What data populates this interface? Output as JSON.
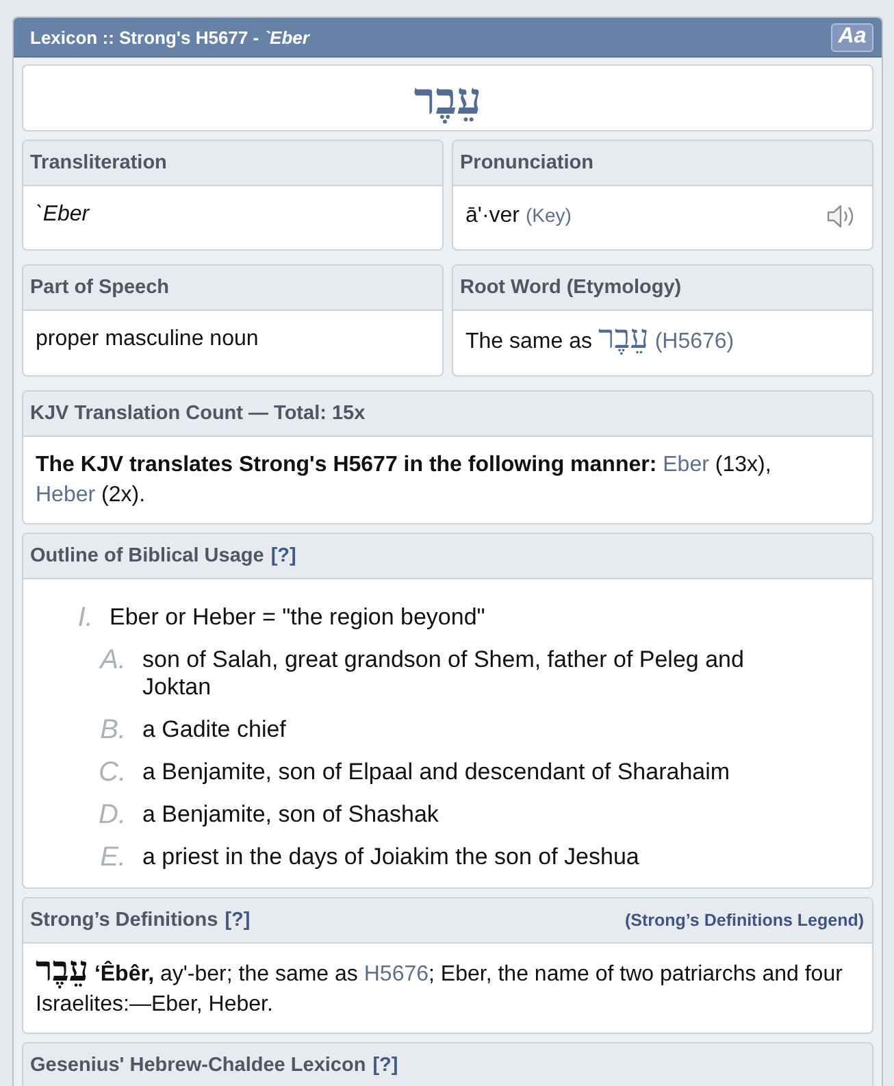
{
  "panel": {
    "title": "Lexicon :: Strong's H5677 - *`Eber*",
    "font_button": "Aa"
  },
  "headword": "עֵבֶר",
  "transliteration": {
    "heading": "Transliteration",
    "value": "`Eber"
  },
  "pronunciation": {
    "heading": "Pronunciation",
    "value": "ā'·ver",
    "key_link": "(Key)"
  },
  "part_of_speech": {
    "heading": "Part of Speech",
    "value": "proper masculine noun"
  },
  "root_word": {
    "heading": "Root Word (Etymology)",
    "text": "The same as",
    "hebrew_link": "עֵבֶר",
    "number_link": "(H5676)"
  },
  "kjv_count": {
    "heading": "KJV Translation Count — Total: 15x",
    "intro": "The KJV translates Strong's H5677 in the following manner:",
    "translations": [
      {
        "word": "Eber",
        "count": "(13x),"
      },
      {
        "word": "Heber",
        "count": "(2x)."
      }
    ]
  },
  "outline": {
    "heading": "Outline of Biblical Usage",
    "help_link": "[?]",
    "items": [
      {
        "marker": "I.",
        "text": "Eber or Heber = \"the region beyond\"",
        "children": [
          {
            "marker": "A.",
            "text": "son of Salah, great grandson of Shem, father of Peleg and Joktan"
          },
          {
            "marker": "B.",
            "text": "a Gadite chief"
          },
          {
            "marker": "C.",
            "text": "a Benjamite, son of Elpaal and descendant of Sharahaim"
          },
          {
            "marker": "D.",
            "text": "a Benjamite, son of Shashak"
          },
          {
            "marker": "E.",
            "text": "a priest in the days of Joiakim the son of Jeshua"
          }
        ]
      }
    ]
  },
  "strongs_definitions": {
    "heading": "Strong’s Definitions",
    "help_link": "[?]",
    "legend_link": "(Strong’s Definitions Legend)",
    "hebrew": "עֵבֶר",
    "headword": "‘Êbêr,",
    "text": "ay'-ber; the same as",
    "link": "H5676",
    "text_after": "; Eber, the name of two patriarchs and four Israelites:—Eber, Heber."
  },
  "gesenius": {
    "heading": "Gesenius' Hebrew-Chaldee Lexicon",
    "help_link": "[?]"
  }
}
